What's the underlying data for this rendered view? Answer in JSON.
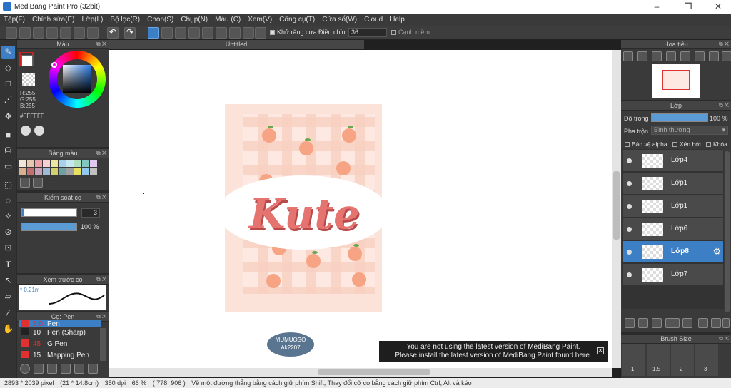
{
  "window": {
    "title": "MediBang Paint Pro (32bit)",
    "min": "–",
    "max": "❐",
    "close": "✕"
  },
  "menu": [
    "Tệp(F)",
    "Chỉnh sửa(E)",
    "Lớp(L)",
    "Bộ lọc(R)",
    "Chọn(S)",
    "Chụp(N)",
    "Màu (C)",
    "Xem(V)",
    "Công cụ(T)",
    "Cửa sổ(W)",
    "Cloud",
    "Help"
  ],
  "toolbar": {
    "antialias_label": "Khử răng cưa",
    "adjust_label": "Điều chỉnh",
    "adjust_value": "36",
    "edge_label": "Cạnh mềm"
  },
  "color_panel": {
    "title": "Màu",
    "r": "R:255",
    "g": "G:255",
    "b": "B:255",
    "hex": "#FFFFFF",
    "fg_color": "#ffffff",
    "bg_color": "#cc2222"
  },
  "swatch_panel": {
    "title": "Bảng màu",
    "dashes": "---",
    "colors": [
      "#f2e6d8",
      "#e8c7b0",
      "#f0a0a8",
      "#f4d0d4",
      "#e8e8a0",
      "#a8d0e8",
      "#c8e8f0",
      "#b0e0c0",
      "#80c8c0",
      "#e0c8f0",
      "#d8b090",
      "#c07070",
      "#c8a0b8",
      "#a0b8d8",
      "#d0d070",
      "#70a0a0",
      "#a0a0a0",
      "#e8e060",
      "#90c8f0",
      "#c0c0c0"
    ]
  },
  "brush_control": {
    "title": "Kiểm soát cọ",
    "size": "3",
    "opacity": "100 %"
  },
  "brush_preview": {
    "title": "Xem trước cọ",
    "size_text": "* 0.21m"
  },
  "brush_panel": {
    "title": "Cọ: Pen",
    "items": [
      {
        "size": "5.0",
        "name": "Pen",
        "color": "#e03030"
      },
      {
        "size": "10",
        "name": "Pen (Sharp)",
        "color": "#222222"
      },
      {
        "size": "45",
        "name": "G Pen",
        "color": "#e03030"
      },
      {
        "size": "15",
        "name": "Mapping Pen",
        "color": "#e03030"
      }
    ]
  },
  "canvas": {
    "tab": "Untitled",
    "artwork_title": "Kute",
    "signature": "MUMUOSO\nAk2207"
  },
  "notice": {
    "line1": "You are not using the latest version of MediBang Paint.",
    "line2": "Please install the latest version of MediBang Paint found here."
  },
  "navigator": {
    "title": "Hoa tiêu"
  },
  "layer_panel": {
    "title": "Lớp",
    "opacity_label": "Độ trong",
    "opacity_value": "100 %",
    "blend_label": "Pha trộn",
    "blend_value": "Bình thường",
    "protect_alpha": "Bảo vệ alpha",
    "clip": "Xén bớt",
    "lock": "Khóa",
    "layers": [
      {
        "name": "Lớp4",
        "selected": false
      },
      {
        "name": "Lớp1",
        "selected": false
      },
      {
        "name": "Lớp1",
        "selected": false
      },
      {
        "name": "Lớp6",
        "selected": false
      },
      {
        "name": "Lớp8",
        "selected": true
      },
      {
        "name": "Lớp7",
        "selected": false
      }
    ]
  },
  "brush_size_panel": {
    "title": "Brush Size",
    "sizes": [
      "1",
      "1.5",
      "2",
      "3"
    ]
  },
  "status": {
    "dimensions": "2893 * 2039 pixel",
    "cm": "(21 * 14.8cm)",
    "dpi": "350 dpi",
    "zoom": "66 %",
    "coords": "( 778, 906 )",
    "hint": "Vẽ một đường thẳng bằng cách giữ phím Shift, Thay đổi cỡ cọ bằng cách giữ phím Ctrl, Alt và kéo"
  }
}
